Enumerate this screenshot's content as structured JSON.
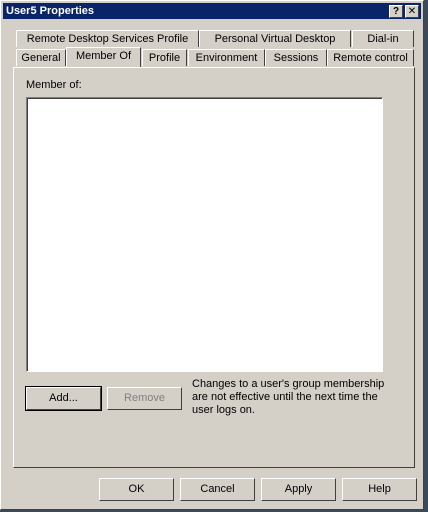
{
  "window": {
    "title": "User5 Properties",
    "help_button": "?",
    "close_button": "✕"
  },
  "tabs": {
    "row1": [
      "Remote Desktop Services Profile",
      "Personal Virtual Desktop",
      "Dial-in"
    ],
    "row2": [
      "General",
      "Member Of",
      "Profile",
      "Environment",
      "Sessions",
      "Remote control"
    ],
    "active": "Member Of"
  },
  "member_of": {
    "label": "Member of:",
    "items": []
  },
  "actions": {
    "add_label": "Add...",
    "remove_label": "Remove"
  },
  "note": {
    "lines": [
      "Changes to a user's group membership",
      "are not effective until the next time the",
      "user logs on."
    ]
  },
  "footer": {
    "ok_label": "OK",
    "cancel_label": "Cancel",
    "apply_label": "Apply",
    "help_label": "Help"
  }
}
